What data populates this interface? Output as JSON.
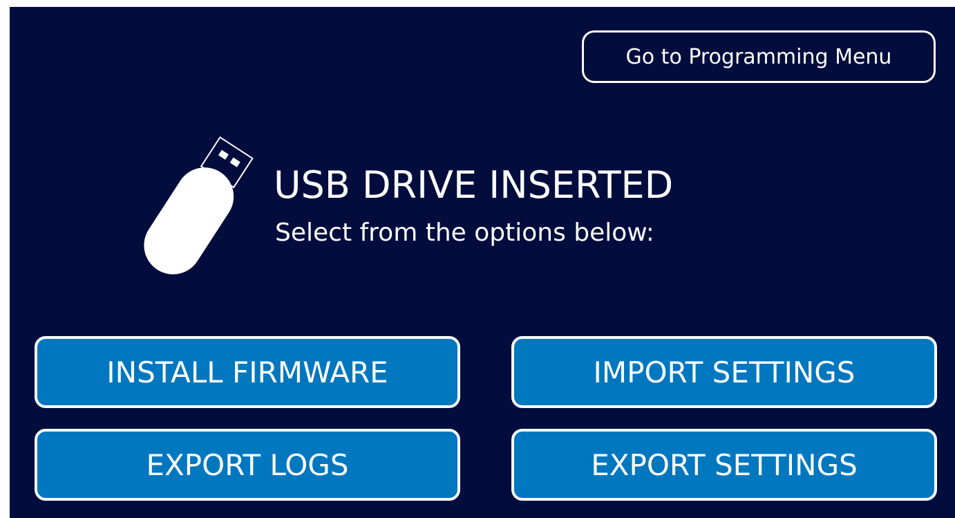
{
  "header": {
    "programming_menu_label": "Go to Programming Menu"
  },
  "status": {
    "icon": "usb-drive-icon",
    "title": "USB DRIVE INSERTED",
    "subtitle": "Select from the options below:"
  },
  "actions": [
    {
      "label": "INSTALL FIRMWARE"
    },
    {
      "label": "IMPORT SETTINGS"
    },
    {
      "label": "EXPORT LOGS"
    },
    {
      "label": "EXPORT SETTINGS"
    }
  ],
  "colors": {
    "background": "#020c3d",
    "button_fill": "#0077bf",
    "text": "#ffffff"
  }
}
